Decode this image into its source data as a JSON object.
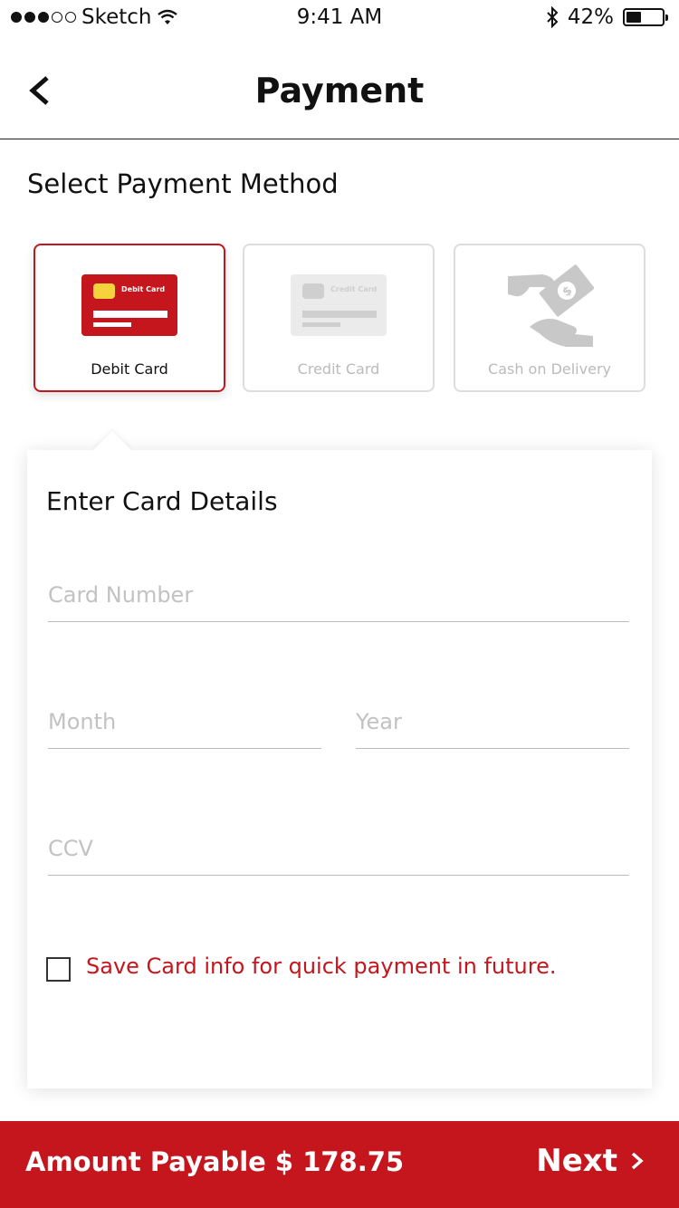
{
  "status_bar": {
    "carrier": "Sketch",
    "time": "9:41 AM",
    "battery": "42%",
    "battery_level": 0.42,
    "signal_bars_filled": 3,
    "signal_bars_total": 5
  },
  "nav": {
    "title": "Payment",
    "back_icon": "chevron-left-icon"
  },
  "section_title": "Select Payment Method",
  "payment_methods": [
    {
      "label": "Debit Card",
      "card_text": "Debit Card",
      "selected": true
    },
    {
      "label": "Credit Card",
      "card_text": "Credit Card",
      "selected": false
    },
    {
      "label": "Cash on Delivery",
      "icon": "cash-hand-icon",
      "selected": false
    }
  ],
  "card_details": {
    "title": "Enter Card Details",
    "card_number_placeholder": "Card Number",
    "month_placeholder": "Month",
    "year_placeholder": "Year",
    "ccv_placeholder": "CCV",
    "save_card_label": "Save Card info for quick payment in future.",
    "save_card_checked": false
  },
  "footer": {
    "amount_label": "Amount Payable $ 178.75",
    "next_label": "Next",
    "next_icon": "chevron-right-icon"
  },
  "colors": {
    "accent": "#c4161c",
    "chip_yellow": "#f5d33c",
    "inactive_gray": "#bbbbbb"
  }
}
